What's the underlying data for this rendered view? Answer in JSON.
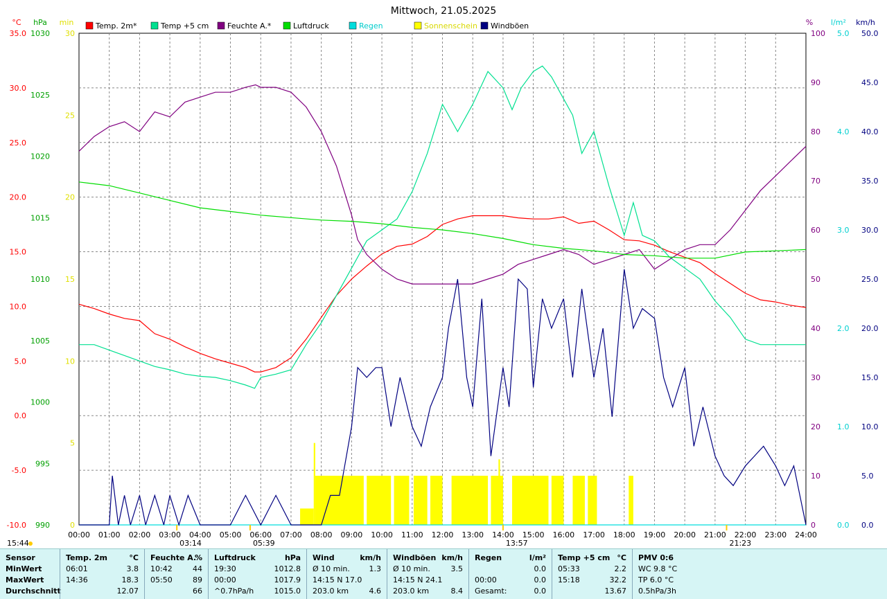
{
  "chart_data": {
    "type": "line",
    "title": "Mittwoch, 21.05.2025",
    "x_ticks": [
      "00:00",
      "01:00",
      "02:00",
      "03:00",
      "04:00",
      "05:00",
      "06:00",
      "07:00",
      "08:00",
      "09:00",
      "10:00",
      "11:00",
      "12:00",
      "13:00",
      "14:00",
      "15:00",
      "16:00",
      "17:00",
      "18:00",
      "19:00",
      "20:00",
      "21:00",
      "22:00",
      "23:00",
      "24:00"
    ],
    "xlim": [
      0,
      24
    ],
    "grid": true,
    "legend_placement": "top",
    "axes": {
      "temp": {
        "unit": "°C",
        "ylim": [
          -10,
          35
        ],
        "ticks": [
          "35.0",
          "30.0",
          "25.0",
          "20.0",
          "15.0",
          "10.0",
          "5.0",
          "0.0",
          "-5.0",
          "-10.0"
        ],
        "color": "#ff0000"
      },
      "pressure": {
        "unit": "hPa",
        "ylim": [
          990,
          1030
        ],
        "ticks": [
          "1030",
          "1025",
          "1020",
          "1015",
          "1010",
          "1005",
          "1000",
          "995",
          "990"
        ],
        "color": "#00a000"
      },
      "minutes": {
        "unit": "min",
        "ylim": [
          0,
          30
        ],
        "ticks": [
          "30",
          "25",
          "20",
          "15",
          "10",
          "5",
          "0"
        ],
        "color": "#e0e000"
      },
      "humidity": {
        "unit": "%",
        "ylim": [
          0,
          100
        ],
        "ticks": [
          "100",
          "90",
          "80",
          "70",
          "60",
          "50",
          "40",
          "30",
          "20",
          "10",
          "0"
        ],
        "color": "#800080"
      },
      "rain": {
        "unit": "l/m²",
        "ylim": [
          0,
          5
        ],
        "ticks": [
          "5.0",
          "4.0",
          "3.0",
          "2.0",
          "1.0",
          "0.0"
        ],
        "color": "#00d0d0"
      },
      "wind": {
        "unit": "km/h",
        "ylim": [
          0,
          50
        ],
        "ticks": [
          "50.0",
          "45.0",
          "40.0",
          "35.0",
          "30.0",
          "25.0",
          "20.0",
          "15.0",
          "10.0",
          "5.0",
          "0.0"
        ],
        "color": "#000080"
      }
    },
    "legend": [
      {
        "name": "Temp. 2m*",
        "color": "#ff0000"
      },
      {
        "name": "Temp +5 cm",
        "color": "#00e090"
      },
      {
        "name": "Feuchte A.*",
        "color": "#800080"
      },
      {
        "name": "Luftdruck",
        "color": "#00dd00"
      },
      {
        "name": "Regen",
        "color": "#00dddd"
      },
      {
        "name": "Sonnenschein",
        "color": "#ffff00"
      },
      {
        "name": "Windböen",
        "color": "#000080"
      }
    ],
    "events": [
      {
        "time": 3.23,
        "label": "03:14"
      },
      {
        "time": 5.65,
        "label": "05:39"
      },
      {
        "time": 14.0,
        "label": "13:57"
      },
      {
        "time": 21.38,
        "label": "21:23"
      }
    ],
    "left_time_label": "15:44",
    "series": [
      {
        "name": "Temp. 2m*",
        "axis": "temp",
        "color": "#ff0000",
        "x": [
          0,
          0.5,
          1,
          1.5,
          2,
          2.5,
          3,
          3.5,
          4,
          4.5,
          5,
          5.5,
          5.8,
          6,
          6.5,
          7,
          7.5,
          8,
          8.5,
          9,
          9.5,
          10,
          10.5,
          11,
          11.5,
          12,
          12.5,
          13,
          13.5,
          14,
          14.5,
          15,
          15.5,
          16,
          16.5,
          17,
          17.5,
          18,
          18.5,
          19,
          19.5,
          20,
          20.5,
          21,
          21.5,
          22,
          22.5,
          23,
          23.5,
          24
        ],
        "y": [
          10.2,
          9.8,
          9.3,
          8.9,
          8.7,
          7.5,
          7.0,
          6.3,
          5.7,
          5.2,
          4.8,
          4.4,
          4.0,
          4.0,
          4.4,
          5.3,
          7.0,
          9.0,
          11.0,
          12.5,
          13.7,
          14.8,
          15.5,
          15.7,
          16.4,
          17.5,
          18.0,
          18.3,
          18.3,
          18.3,
          18.1,
          18.0,
          18.0,
          18.2,
          17.6,
          17.8,
          17.0,
          16.1,
          16.0,
          15.6,
          15.0,
          14.5,
          14.0,
          13.0,
          12.1,
          11.2,
          10.6,
          10.4,
          10.1,
          9.9
        ]
      },
      {
        "name": "Temp +5 cm",
        "axis": "temp",
        "color": "#00e090",
        "x": [
          0,
          0.5,
          1,
          1.5,
          2,
          2.5,
          3,
          3.5,
          4,
          4.5,
          5,
          5.5,
          5.8,
          6,
          6.5,
          7,
          7.5,
          8,
          8.5,
          9,
          9.5,
          10,
          10.5,
          11,
          11.5,
          12,
          12.5,
          13,
          13.5,
          14,
          14.3,
          14.6,
          15,
          15.3,
          15.6,
          16,
          16.3,
          16.6,
          17,
          17.5,
          18,
          18.3,
          18.6,
          19,
          19.5,
          20,
          20.5,
          21,
          21.5,
          22,
          22.5,
          23,
          23.5,
          24
        ],
        "y": [
          6.5,
          6.5,
          6.0,
          5.5,
          5.0,
          4.5,
          4.2,
          3.8,
          3.6,
          3.5,
          3.2,
          2.8,
          2.5,
          3.5,
          3.8,
          4.2,
          6.5,
          8.5,
          11.0,
          13.5,
          16.0,
          17.0,
          18.0,
          20.5,
          24.0,
          28.5,
          26.0,
          28.5,
          31.5,
          30.0,
          28.0,
          30.0,
          31.5,
          32.0,
          31.0,
          29.0,
          27.5,
          24.0,
          26.0,
          21.0,
          16.5,
          19.5,
          16.5,
          16.0,
          14.5,
          13.5,
          12.5,
          10.5,
          9.0,
          7.0,
          6.5,
          6.5,
          6.5,
          6.5
        ]
      },
      {
        "name": "Feuchte A.*",
        "axis": "humidity",
        "color": "#800080",
        "x": [
          0,
          0.5,
          1,
          1.5,
          2,
          2.5,
          3,
          3.5,
          4,
          4.5,
          5,
          5.5,
          5.83,
          6,
          6.5,
          7,
          7.5,
          8,
          8.5,
          9,
          9.2,
          9.5,
          10,
          10.5,
          11,
          11.5,
          12,
          12.5,
          13,
          13.5,
          14,
          14.5,
          15,
          15.5,
          16,
          16.5,
          17,
          17.5,
          18,
          18.5,
          19,
          19.5,
          20,
          20.5,
          21,
          21.5,
          22,
          22.5,
          23,
          23.5,
          24
        ],
        "y": [
          76,
          79,
          81,
          82,
          80,
          84,
          83,
          86,
          87,
          88,
          88,
          89,
          89.5,
          89,
          89,
          88,
          85,
          80,
          73,
          63,
          58,
          55,
          52,
          50,
          49,
          49,
          49,
          49,
          49,
          50,
          51,
          53,
          54,
          55,
          56,
          55,
          53,
          54,
          55,
          56,
          52,
          54,
          56,
          57,
          57,
          60,
          64,
          68,
          71,
          74,
          77
        ]
      },
      {
        "name": "Luftdruck",
        "axis": "pressure",
        "color": "#00dd00",
        "x": [
          0,
          1,
          2,
          3,
          4,
          5,
          6,
          7,
          8,
          9,
          10,
          11,
          12,
          13,
          14,
          15,
          16,
          17,
          18,
          19,
          20,
          21,
          22,
          23,
          24
        ],
        "y": [
          1017.9,
          1017.6,
          1017.0,
          1016.4,
          1015.8,
          1015.5,
          1015.2,
          1015.0,
          1014.8,
          1014.7,
          1014.5,
          1014.2,
          1014.0,
          1013.7,
          1013.3,
          1012.8,
          1012.5,
          1012.3,
          1012.0,
          1011.9,
          1011.7,
          1011.7,
          1012.2,
          1012.3,
          1012.4
        ]
      },
      {
        "name": "Regen",
        "axis": "rain",
        "color": "#00dddd",
        "x": [
          0,
          24
        ],
        "y": [
          0,
          0
        ]
      },
      {
        "name": "Windböen",
        "axis": "wind",
        "color": "#000080",
        "x": [
          0,
          0.5,
          1,
          1.1,
          1.3,
          1.5,
          1.7,
          2,
          2.2,
          2.5,
          2.8,
          3,
          3.3,
          3.6,
          4,
          4.5,
          5,
          5.5,
          6,
          6.5,
          7,
          7.5,
          8,
          8.3,
          8.6,
          9,
          9.2,
          9.5,
          9.8,
          10,
          10.3,
          10.6,
          11,
          11.3,
          11.6,
          12,
          12.2,
          12.5,
          12.8,
          13,
          13.3,
          13.6,
          14,
          14.2,
          14.5,
          14.8,
          15,
          15.3,
          15.6,
          16,
          16.3,
          16.6,
          17,
          17.3,
          17.6,
          18,
          18.3,
          18.6,
          19,
          19.3,
          19.6,
          20,
          20.3,
          20.6,
          21,
          21.3,
          21.6,
          22,
          22.3,
          22.6,
          23,
          23.3,
          23.6,
          24
        ],
        "y": [
          0,
          0,
          0,
          5,
          0,
          3,
          0,
          3,
          0,
          3,
          0,
          3,
          0,
          3,
          0,
          0,
          0,
          3,
          0,
          3,
          0,
          0,
          0,
          3,
          3,
          10,
          16,
          15,
          16,
          16,
          10,
          15,
          10,
          8,
          12,
          15,
          20,
          25,
          15,
          12,
          23,
          7,
          16,
          12,
          25,
          24,
          14,
          23,
          20,
          23,
          15,
          24,
          15,
          20,
          11,
          26,
          20,
          22,
          21,
          15,
          12,
          16,
          8,
          12,
          7,
          5,
          4,
          6,
          7,
          8,
          6,
          4,
          6,
          0
        ]
      }
    ],
    "bars": {
      "name": "Sonnenschein",
      "axis": "minutes",
      "color": "#ffff00",
      "segments": [
        {
          "from": 7.3,
          "to": 7.75,
          "value": 1
        },
        {
          "from": 7.75,
          "to": 7.8,
          "value": 5
        },
        {
          "from": 7.8,
          "to": 9.4,
          "value": 3
        },
        {
          "from": 9.5,
          "to": 10.3,
          "value": 3
        },
        {
          "from": 10.4,
          "to": 10.9,
          "value": 3
        },
        {
          "from": 11.05,
          "to": 11.5,
          "value": 3
        },
        {
          "from": 11.6,
          "to": 12.0,
          "value": 3
        },
        {
          "from": 12.3,
          "to": 13.5,
          "value": 3
        },
        {
          "from": 13.6,
          "to": 14.0,
          "value": 3
        },
        {
          "from": 13.85,
          "to": 13.9,
          "value": 4
        },
        {
          "from": 14.3,
          "to": 15.5,
          "value": 3
        },
        {
          "from": 15.6,
          "to": 16.0,
          "value": 3
        },
        {
          "from": 16.3,
          "to": 16.7,
          "value": 3
        },
        {
          "from": 16.8,
          "to": 17.1,
          "value": 3
        },
        {
          "from": 18.15,
          "to": 18.3,
          "value": 3
        }
      ]
    }
  },
  "footer": {
    "columns": [
      {
        "title": "Sensor",
        "unit": "",
        "rows": [
          [
            "MinWert",
            ""
          ],
          [
            "MaxWert",
            ""
          ],
          [
            "Durchschnitt",
            ""
          ]
        ]
      },
      {
        "title": "Temp. 2m",
        "unit": "°C",
        "rows": [
          [
            "06:01",
            "3.8"
          ],
          [
            "14:36",
            "18.3"
          ],
          [
            "",
            "12.07"
          ]
        ]
      },
      {
        "title": "Feuchte A.",
        "unit": "%",
        "rows": [
          [
            "10:42",
            "44"
          ],
          [
            "05:50",
            "89"
          ],
          [
            "",
            "66"
          ]
        ]
      },
      {
        "title": "Luftdruck",
        "unit": "hPa",
        "rows": [
          [
            "19:30",
            "1012.8"
          ],
          [
            "00:00",
            "1017.9"
          ],
          [
            "^0.7hPa/h",
            "1015.0"
          ]
        ]
      },
      {
        "title": "Wind",
        "unit": "km/h",
        "rows": [
          [
            "Ø 10 min.",
            "1.3"
          ],
          [
            "14:15    N 17.0",
            ""
          ],
          [
            "203.0 km",
            "4.6"
          ]
        ]
      },
      {
        "title": "Windböen",
        "unit": "km/h",
        "rows": [
          [
            "Ø 10 min.",
            "3.5"
          ],
          [
            "14:15    N 24.1",
            ""
          ],
          [
            "203.0 km",
            "8.4"
          ]
        ]
      },
      {
        "title": "Regen",
        "unit": "l/m²",
        "rows": [
          [
            "",
            "0.0"
          ],
          [
            "00:00",
            "0.0"
          ],
          [
            "Gesamt:",
            "0.0"
          ]
        ]
      },
      {
        "title": "Temp +5 cm",
        "unit": "°C",
        "rows": [
          [
            "05:33",
            "2.2"
          ],
          [
            "15:18",
            "32.2"
          ],
          [
            "",
            "13.67"
          ]
        ]
      },
      {
        "title": "PMV 0:6",
        "unit": "",
        "rows": [
          [
            "WC 9.8 °C",
            ""
          ],
          [
            "TP 6.0 °C",
            ""
          ],
          [
            "0.5hPa/3h",
            ""
          ]
        ]
      }
    ]
  }
}
